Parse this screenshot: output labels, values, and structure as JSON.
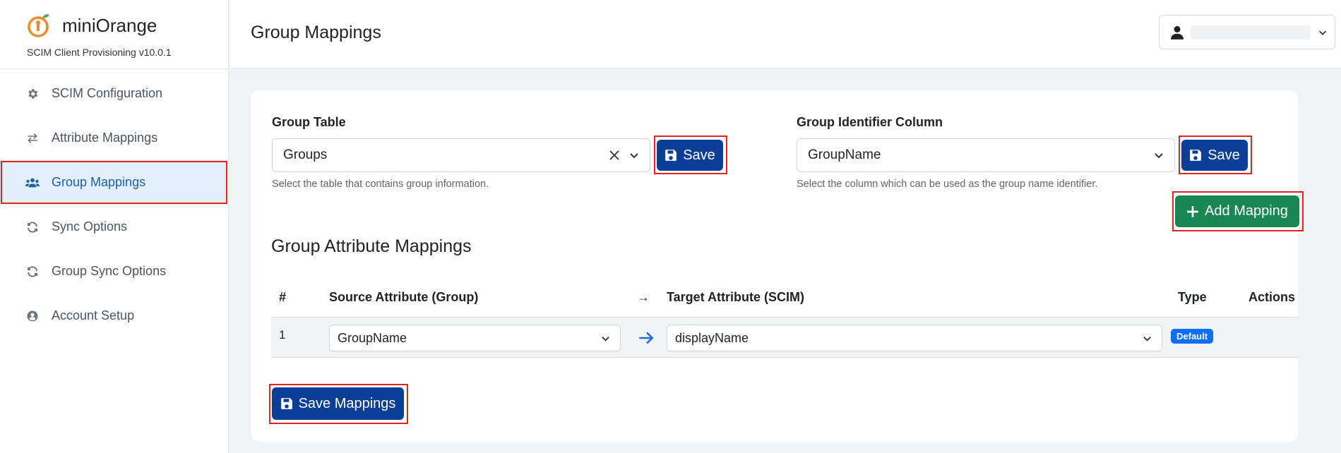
{
  "brand": {
    "name": "miniOrange",
    "version": "SCIM Client Provisioning v10.0.1",
    "accent_color": "#f08a24"
  },
  "sidebar": {
    "items": [
      {
        "label": "SCIM Configuration",
        "icon": "gear-icon"
      },
      {
        "label": "Attribute Mappings",
        "icon": "exchange-arrows-icon"
      },
      {
        "label": "Group Mappings",
        "icon": "users-icon",
        "active": true
      },
      {
        "label": "Sync Options",
        "icon": "sync-icon"
      },
      {
        "label": "Group Sync Options",
        "icon": "sync-icon"
      },
      {
        "label": "Account Setup",
        "icon": "user-circle-icon"
      }
    ]
  },
  "header": {
    "title": "Group Mappings",
    "user_menu": {
      "icon": "user-icon",
      "name": ""
    }
  },
  "group_table": {
    "label": "Group Table",
    "value": "Groups",
    "help": "Select the table that contains group information.",
    "save_label": "Save"
  },
  "group_identifier": {
    "label": "Group Identifier Column",
    "value": "GroupName",
    "help": "Select the column which can be used as the group name identifier.",
    "save_label": "Save"
  },
  "mappings": {
    "title": "Group Attribute Mappings",
    "add_label": "Add Mapping",
    "columns": [
      "#",
      "Source Attribute (Group)",
      "→",
      "Target Attribute (SCIM)",
      "Type",
      "Actions"
    ],
    "rows": [
      {
        "index": "1",
        "source": "GroupName",
        "target": "displayName",
        "type": "Default"
      }
    ],
    "save_label": "Save Mappings"
  },
  "colors": {
    "primary": "#0b3f97",
    "success": "#198754",
    "highlight": "#e02424",
    "active_nav_bg": "#e3f0fb"
  }
}
